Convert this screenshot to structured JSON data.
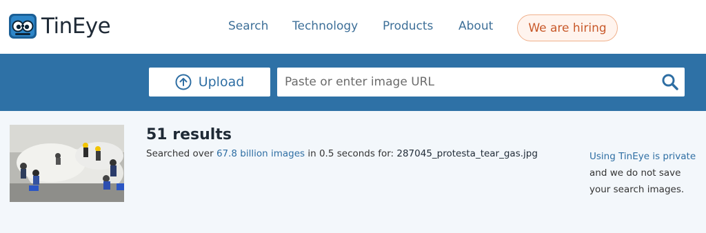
{
  "brand": {
    "name": "TinEye"
  },
  "nav": {
    "items": [
      {
        "label": "Search"
      },
      {
        "label": "Technology"
      },
      {
        "label": "Products"
      },
      {
        "label": "About"
      }
    ],
    "hiring_label": "We are hiring"
  },
  "search": {
    "upload_label": "Upload",
    "url_placeholder": "Paste or enter image URL",
    "url_value": ""
  },
  "results": {
    "count_text": "51 results",
    "searched_prefix": "Searched over ",
    "index_size": "67.8 billion images",
    "searched_middle": " in 0.5 seconds for: ",
    "filename": "287045_protesta_tear_gas.jpg"
  },
  "privacy": {
    "link_text": "Using TinEye is private",
    "body_text": "and we do not save your search images."
  },
  "colors": {
    "brand_blue": "#2e71a6",
    "link_blue": "#2e6ea3",
    "hiring_orange": "#c8592a"
  }
}
